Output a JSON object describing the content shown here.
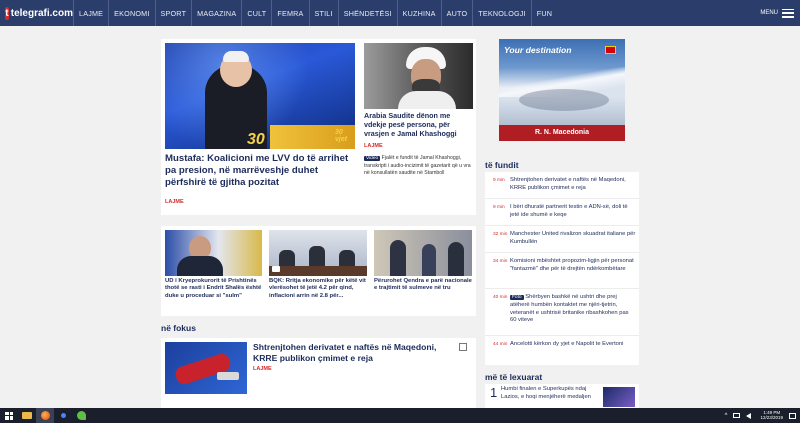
{
  "site": {
    "logo_letter": "t",
    "name": "telegrafi.com"
  },
  "nav": [
    "LAJME",
    "EKONOMI",
    "SPORT",
    "MAGAZINA",
    "CULT",
    "FEMRA",
    "STILI",
    "SHËNDETËSI",
    "KUZHINA",
    "AUTO",
    "TEKNOLOGJI",
    "FUN"
  ],
  "menu_label": "MENU",
  "main_story": {
    "title": "Mustafa: Koalicioni me LVV do të arrihet pa presion, në marrëveshje duhet përfshirë të gjitha pozitat",
    "category": "LAJME",
    "image_caption": "30 vjet",
    "image_number": "30"
  },
  "side_story": {
    "title": "Arabia Saudite dënon me vdekje pesë persona, për vrasjen e Jamal Khashoggi",
    "category": "LAJME",
    "badge": "Video",
    "summary": "Fjalët e fundit të Jamal Khashoggi, transkripti i audio-incizimit të gazetarit që u vra në konsullatën saudite në Stamboll"
  },
  "sub_stories": [
    {
      "title": "UD i Kryeprokurorit të Prishtinës thotë se rasti i Endrit Shalës është duke u proceduar si \"sulm\""
    },
    {
      "title": "BQK: Rritja ekonomike për këtë vit vlerësohet të jetë 4.2 për qind, inflacioni arrin në 2.8 për..."
    },
    {
      "title": "Përurohet Qendra e parë nacionale e trajtimit të sulmeve në tru"
    }
  ],
  "ne_fokus": {
    "label": "në fokus",
    "title": "Shtrenjtohen derivatet e naftës në Maqedoni, KRRE publikon çmimet e reja",
    "category": "LAJME"
  },
  "ad": {
    "title": "Your destination",
    "caption": "R. N. Macedonia"
  },
  "te_fundit": {
    "label": "të fundit",
    "items": [
      {
        "time": "9 min",
        "text": "Shtrenjtohen derivatet e naftës në Maqedoni, KRRE publikon çmimet e reja",
        "badge": ""
      },
      {
        "time": "9 min",
        "text": "I bëri dhuratë partnerit testin e ADN-së, doli të jetë ide shumë e keqe",
        "badge": ""
      },
      {
        "time": "32 min",
        "text": "Manchester United rivalizon skuadrat italiane për Kumbullën",
        "badge": ""
      },
      {
        "time": "34 min",
        "text": "Komisioni mbështet propozim-ligjin për personat \"fantazmë\" dhe për të drejtën ndërkombëtare",
        "badge": ""
      },
      {
        "time": "40 min",
        "text": "Shërbyen bashkë në ushtri dhe prej atëherë humbën kontaktet me njëri-tjetrin, veteranët e ushtrisë britanike ribashkohen pas 60 viteve",
        "badge": "Foto"
      },
      {
        "time": "44 min",
        "text": "Ancelotti kërkon dy yjet e Napolit te Evertoni",
        "badge": ""
      }
    ]
  },
  "me_te_lexuarat": {
    "label": "më të lexuarat",
    "items": [
      {
        "rank": "1",
        "text": "Humbi finalen e Superkupës ndaj Lazios, e hoqi menjëherë medaljen"
      }
    ]
  },
  "clock": {
    "time": "1:49 PM",
    "date": "12/23/2019"
  },
  "colors": {
    "header": "#2b3d6b",
    "accent": "#d52a2a",
    "headline": "#1c2b5a"
  }
}
